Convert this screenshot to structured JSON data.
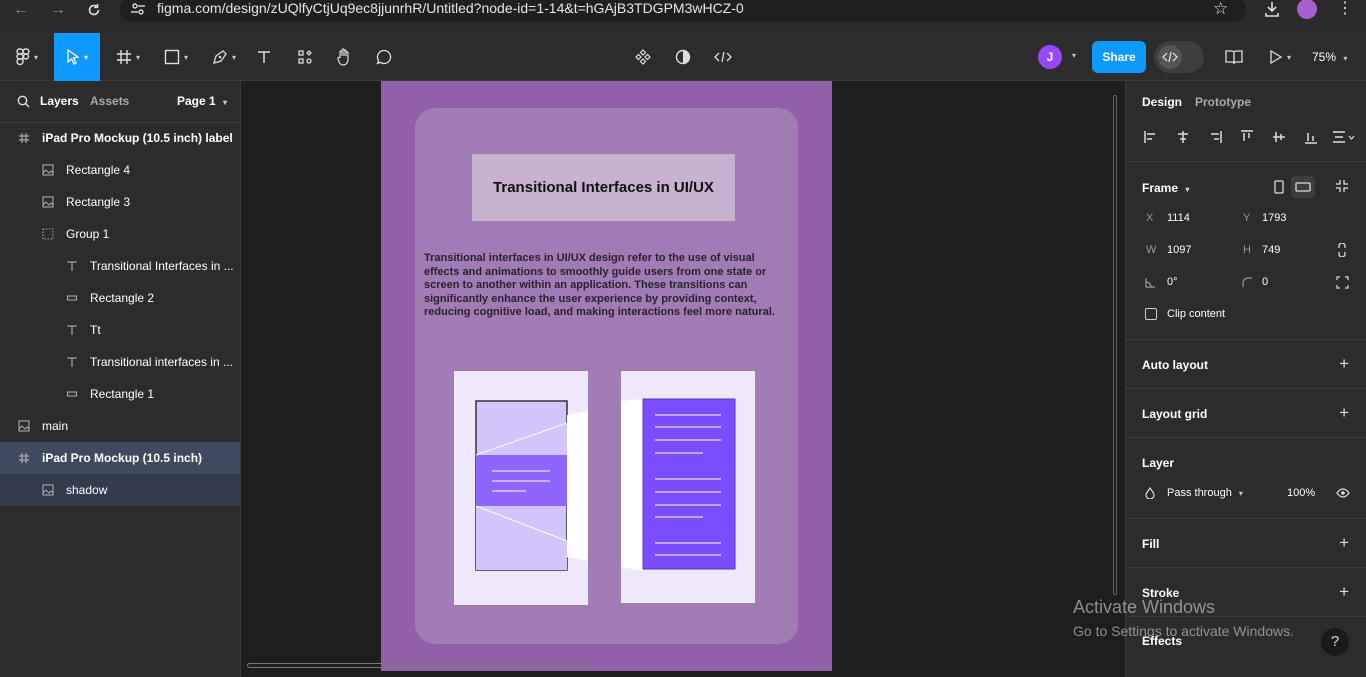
{
  "browser": {
    "url": "figma.com/design/zUQlfyCtjUq9ec8jjunrhR/Untitled?node-id=1-14&t=hGAjB3TDGPM3wHCZ-0"
  },
  "toolbar": {
    "share_label": "Share",
    "avatar_initial": "J",
    "zoom": "75%",
    "accent": "#0d99ff"
  },
  "left_panel": {
    "tabs": [
      "Layers",
      "Assets"
    ],
    "page": "Page 1",
    "layers": [
      {
        "label": "iPad Pro Mockup (10.5 inch) label",
        "icon": "frame-icon",
        "indent": 0,
        "bold": true
      },
      {
        "label": "Rectangle 4",
        "icon": "image-icon",
        "indent": 1
      },
      {
        "label": "Rectangle 3",
        "icon": "image-icon",
        "indent": 1
      },
      {
        "label": "Group 1",
        "icon": "group-icon",
        "indent": 1
      },
      {
        "label": "Transitional Interfaces in ...",
        "icon": "text-icon",
        "indent": 2
      },
      {
        "label": "Rectangle 2",
        "icon": "rectangle-icon",
        "indent": 2
      },
      {
        "label": "Tt",
        "icon": "text-icon",
        "indent": 2
      },
      {
        "label": "Transitional interfaces in ...",
        "icon": "text-icon",
        "indent": 2
      },
      {
        "label": "Rectangle 1",
        "icon": "rectangle-icon",
        "indent": 2
      },
      {
        "label": "main",
        "icon": "image-icon",
        "indent": 0
      },
      {
        "label": "iPad Pro Mockup (10.5 inch)",
        "icon": "frame-icon",
        "indent": 0,
        "bold": true,
        "selected": true
      },
      {
        "label": "shadow",
        "icon": "image-icon",
        "indent": 1,
        "selected": true
      }
    ]
  },
  "canvas": {
    "title": "Transitional Interfaces in UI/UX",
    "paragraph": "Transitional interfaces in UI/UX design refer to the use of visual effects and animations to smoothly guide users from one state or screen to another within an application. These transitions can significantly enhance the user experience by providing context, reducing cognitive load, and making interactions feel more natural.",
    "frame_color": "#9160a8",
    "card_color": "#a07cb4",
    "illustration_color": "#7a4dff"
  },
  "right_panel": {
    "tabs": [
      "Design",
      "Prototype"
    ],
    "frame_label": "Frame",
    "x_label": "X",
    "x": "1114",
    "y_label": "Y",
    "y": "1793",
    "w_label": "W",
    "w": "1097",
    "h_label": "H",
    "h": "749",
    "rotation": "0°",
    "radius": "0",
    "clip_content": "Clip content",
    "sections": [
      "Auto layout",
      "Layout grid",
      "Layer",
      "Fill",
      "Stroke",
      "Effects"
    ],
    "blend_mode": "Pass through",
    "opacity": "100%"
  },
  "watermark": {
    "line1": "Activate Windows",
    "line2": "Go to Settings to activate Windows."
  }
}
